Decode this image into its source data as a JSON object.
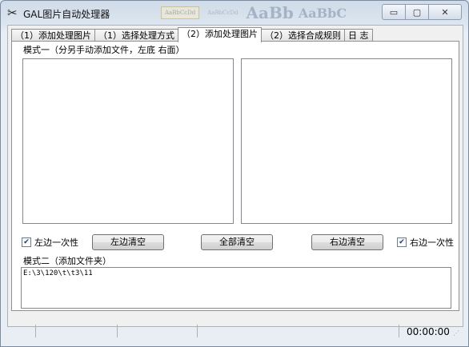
{
  "window": {
    "title": "GAL图片自动处理器",
    "app_icon": "scissors-icon",
    "background_ghost": {
      "style1": "AaBbCcDd",
      "style2": "AaBbCcDd",
      "big1": "AaBb",
      "big2": "AaBbC"
    },
    "controls": {
      "minimize": "▭",
      "maximize": "▢",
      "close": "✕"
    }
  },
  "tabs": [
    {
      "label": "（1）添加处理图片",
      "active": false
    },
    {
      "label": "（1）选择处理方式",
      "active": false
    },
    {
      "label": "（2）添加处理图片",
      "active": true
    },
    {
      "label": "（2）选择合成规则",
      "active": false
    },
    {
      "label": "日 志",
      "active": false
    }
  ],
  "panel": {
    "mode1_label": "模式一（分另手动添加文件，左底 右面）",
    "left_once": {
      "label": "左边一次性",
      "checked": true
    },
    "clear_left": "左边清空",
    "clear_all": "全部清空",
    "clear_right": "右边清空",
    "right_once": {
      "label": "右边一次性",
      "checked": true
    },
    "mode2_label": "模式二（添加文件夹）",
    "folder_path": "E:\\3\\120\\t\\t3\\11"
  },
  "statusbar": {
    "time": "00:00:00"
  },
  "colors": {
    "accent_check": "#1f3f77",
    "window_frame": "#7a8aa0"
  }
}
